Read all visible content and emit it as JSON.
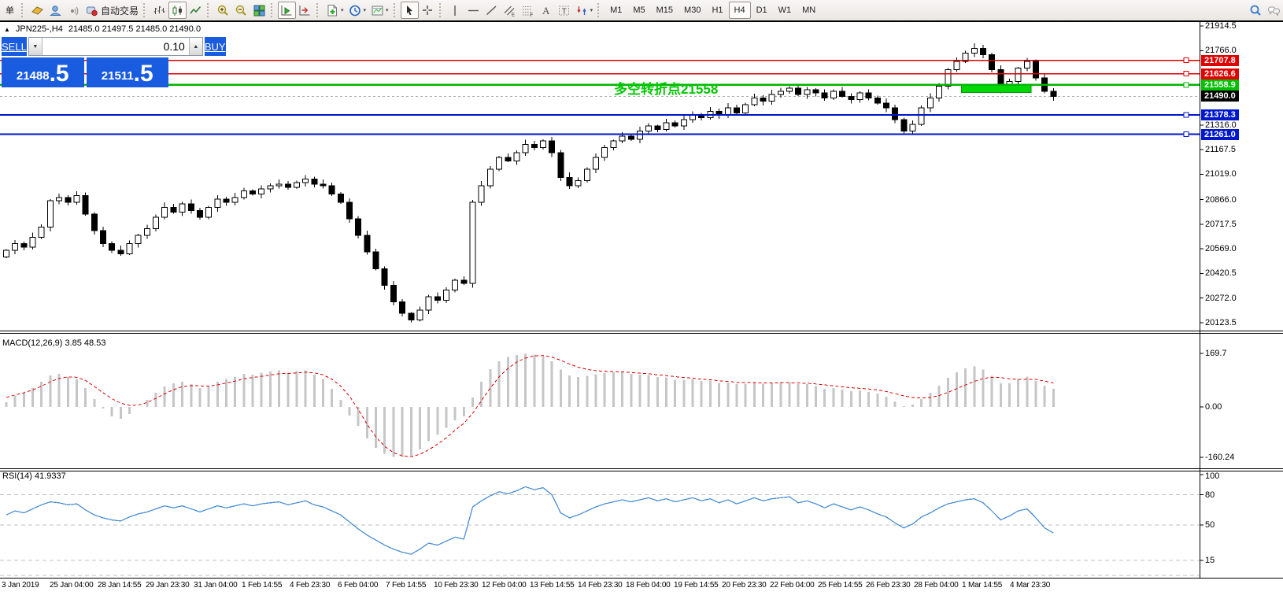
{
  "accent_colors": {
    "panel_blue": "#1a5ce0",
    "line_red": "#e00000",
    "line_green": "#00b400",
    "line_blue": "#0014c8",
    "badge_green": "#00c000",
    "badge_blue": "#0018cc",
    "annotation_green": "#00c800",
    "rsi_blue": "#4a8fd4",
    "macd_gray": "#c6c6c6"
  },
  "toolbar": {
    "caret_glyph": "▾",
    "groups": [
      {
        "name": "orders",
        "items": [
          {
            "name": "new-order-button",
            "label": "单"
          }
        ]
      },
      {
        "name": "quick",
        "items": [
          {
            "name": "market-watch-button",
            "icon": "book"
          },
          {
            "name": "profile-button",
            "icon": "profile"
          },
          {
            "name": "signals-button",
            "icon": "signal"
          },
          {
            "name": "autotrading-button",
            "icon": "autotrade",
            "label": "自动交易"
          }
        ]
      },
      {
        "name": "chart-type",
        "items": [
          {
            "name": "bar-chart-button",
            "icon": "bars"
          },
          {
            "name": "candlestick-chart-button",
            "icon": "candles",
            "active": true
          },
          {
            "name": "line-chart-button",
            "icon": "linechart"
          }
        ]
      },
      {
        "name": "zoom",
        "items": [
          {
            "name": "zoom-in-button",
            "icon": "zoomin"
          },
          {
            "name": "zoom-out-button",
            "icon": "zoomout"
          },
          {
            "name": "tile-windows-button",
            "icon": "tile"
          }
        ]
      },
      {
        "name": "scrolling",
        "items": [
          {
            "name": "auto-scroll-button",
            "icon": "autoscroll",
            "active": true
          },
          {
            "name": "chart-shift-button",
            "icon": "shift"
          }
        ]
      },
      {
        "name": "insert",
        "items": [
          {
            "name": "indicators-button",
            "icon": "indicator",
            "caret": true
          },
          {
            "name": "periods-button",
            "icon": "clock",
            "caret": true
          },
          {
            "name": "templates-button",
            "icon": "template",
            "caret": true
          }
        ]
      },
      {
        "name": "pointer",
        "items": [
          {
            "name": "cursor-button",
            "icon": "cursor",
            "active": true
          },
          {
            "name": "crosshair-button",
            "icon": "crosshair"
          }
        ]
      },
      {
        "name": "draw",
        "items": [
          {
            "name": "vertical-line-button",
            "icon": "vline"
          },
          {
            "name": "horizontal-line-button",
            "icon": "hline"
          },
          {
            "name": "trendline-button",
            "icon": "trend"
          },
          {
            "name": "equidistant-channel-button",
            "icon": "channel"
          },
          {
            "name": "fibonacci-button",
            "icon": "fibo"
          },
          {
            "name": "text-button",
            "icon": "textA"
          },
          {
            "name": "text-label-button",
            "icon": "labelT"
          },
          {
            "name": "arrows-button",
            "icon": "shapes",
            "caret": true
          }
        ]
      },
      {
        "name": "timeframes",
        "items": [
          {
            "name": "timeframe-m1",
            "label": "M1"
          },
          {
            "name": "timeframe-m5",
            "label": "M5"
          },
          {
            "name": "timeframe-m15",
            "label": "M15"
          },
          {
            "name": "timeframe-m30",
            "label": "M30"
          },
          {
            "name": "timeframe-h1",
            "label": "H1"
          },
          {
            "name": "timeframe-h4",
            "label": "H4",
            "active": true
          },
          {
            "name": "timeframe-d1",
            "label": "D1"
          },
          {
            "name": "timeframe-w1",
            "label": "W1"
          },
          {
            "name": "timeframe-mn",
            "label": "MN"
          }
        ]
      }
    ],
    "right_items": [
      {
        "name": "search-button",
        "icon": "search"
      },
      {
        "name": "chat-button",
        "icon": "chat"
      }
    ]
  },
  "chart": {
    "collapse_glyph": "▲",
    "title_symbol": "JPN225-,H4",
    "title_ohlc": "21485.0 21497.5 21485.0 21490.0",
    "annotation": {
      "text": "多空转折点21558",
      "color": "#00c800"
    }
  },
  "trade_panel": {
    "sell_label": "SELL",
    "buy_label": "BUY",
    "lot": "0.10",
    "lot_down_glyph": "▼",
    "lot_up_glyph": "▲",
    "sell_price_main": "21488",
    "sell_price_frac": ".5",
    "buy_price_main": "21511",
    "buy_price_frac": ".5"
  },
  "price_axis": {
    "ticks": [
      "21914.5",
      "21766.0",
      "21316.0",
      "21167.5",
      "21019.0",
      "20866.0",
      "20717.5",
      "20569.0",
      "20420.5",
      "20272.0",
      "20123.5"
    ],
    "badges": [
      {
        "value": "21707.8",
        "color": "#e00000",
        "role": "resistance-line-label"
      },
      {
        "value": "21626.6",
        "color": "#e00000",
        "role": "resistance-line-label"
      },
      {
        "value": "21558.9",
        "color": "#00c000",
        "role": "pivot-line-label"
      },
      {
        "value": "21490.0",
        "color": "#000000",
        "role": "current-price-label"
      },
      {
        "value": "21378.3",
        "color": "#0018cc",
        "role": "support-line-label"
      },
      {
        "value": "21261.0",
        "color": "#0018cc",
        "role": "support-line-label"
      }
    ]
  },
  "macd_pane": {
    "label": "MACD(12,26,9) 3.85 48.53",
    "axis": [
      "169.7",
      "0.00",
      "-160.24"
    ]
  },
  "rsi_pane": {
    "label": "RSI(14) 41.9337",
    "axis": [
      "100",
      "80",
      "50",
      "15"
    ],
    "levels": [
      80,
      50,
      15
    ]
  },
  "time_axis": {
    "labels": [
      "3 Jan 2019",
      "25 Jan 04:00",
      "28 Jan 14:55",
      "29 Jan 23:30",
      "31 Jan 04:00",
      "1 Feb 14:55",
      "4 Feb 23:30",
      "6 Feb 04:00",
      "7 Feb 14:55",
      "10 Feb 23:30",
      "12 Feb 04:00",
      "13 Feb 14:55",
      "14 Feb 23:30",
      "18 Feb 04:00",
      "19 Feb 14:55",
      "20 Feb 23:30",
      "22 Feb 04:00",
      "25 Feb 14:55",
      "26 Feb 23:30",
      "28 Feb 04:00",
      "1 Mar 14:55",
      "4 Mar 23:30"
    ]
  },
  "chart_data": [
    {
      "type": "candlestick",
      "symbol": "JPN225-",
      "period": "H4",
      "open": 21485.0,
      "high": 21497.5,
      "low": 21485.0,
      "close": 21490.0,
      "ylim": [
        20123.5,
        21914.5
      ],
      "closes": [
        20560,
        20600,
        20580,
        20640,
        20700,
        20860,
        20880,
        20850,
        20890,
        20780,
        20680,
        20600,
        20560,
        20540,
        20600,
        20650,
        20690,
        20760,
        20820,
        20790,
        20840,
        20800,
        20760,
        20820,
        20870,
        20850,
        20880,
        20920,
        20900,
        20930,
        20950,
        20960,
        20940,
        20970,
        20990,
        20960,
        20950,
        20900,
        20850,
        20750,
        20650,
        20550,
        20450,
        20350,
        20250,
        20180,
        20140,
        20200,
        20280,
        20260,
        20320,
        20380,
        20360,
        20850,
        20950,
        21050,
        21120,
        21100,
        21150,
        21200,
        21180,
        21220,
        21150,
        21000,
        20950,
        20980,
        21050,
        21120,
        21180,
        21220,
        21250,
        21230,
        21280,
        21310,
        21290,
        21330,
        21310,
        21350,
        21380,
        21360,
        21400,
        21380,
        21420,
        21390,
        21440,
        21480,
        21460,
        21500,
        21520,
        21540,
        21500,
        21530,
        21510,
        21480,
        21520,
        21490,
        21470,
        21510,
        21480,
        21450,
        21420,
        21350,
        21280,
        21320,
        21420,
        21480,
        21550,
        21650,
        21700,
        21750,
        21780,
        21740,
        21650,
        21520,
        21580,
        21660,
        21700,
        21600,
        21520,
        21490
      ],
      "hlines": [
        {
          "price": 21707.8,
          "color": "#e00000",
          "width": 1.5
        },
        {
          "price": 21626.6,
          "color": "#e00000",
          "width": 1.5
        },
        {
          "price": 21558.9,
          "color": "#00b400",
          "width": 2.5
        },
        {
          "price": 21378.3,
          "color": "#0014c8",
          "width": 2
        },
        {
          "price": 21261.0,
          "color": "#0014c8",
          "width": 2
        }
      ],
      "current_price_line": {
        "price": 21490.0,
        "style": "dashed-gray"
      },
      "green_zone": {
        "bar_from": 109,
        "bar_to": 116,
        "price_top": 21558.9,
        "price_bottom": 21512,
        "fill": "#00d800"
      }
    },
    {
      "type": "bar",
      "name": "MACD histogram",
      "ylim": [
        -160.24,
        169.7
      ],
      "values": [
        15,
        35,
        45,
        60,
        80,
        100,
        105,
        95,
        88,
        60,
        25,
        -5,
        -30,
        -38,
        -22,
        0,
        22,
        45,
        65,
        75,
        80,
        72,
        60,
        66,
        80,
        88,
        95,
        105,
        102,
        108,
        112,
        116,
        108,
        113,
        116,
        102,
        88,
        58,
        22,
        -28,
        -60,
        -100,
        -130,
        -148,
        -158,
        -160,
        -155,
        -135,
        -108,
        -88,
        -66,
        -42,
        -30,
        30,
        80,
        120,
        145,
        158,
        165,
        169,
        166,
        160,
        145,
        118,
        100,
        95,
        98,
        104,
        107,
        110,
        110,
        105,
        102,
        101,
        95,
        94,
        86,
        86,
        88,
        82,
        84,
        76,
        78,
        72,
        74,
        78,
        74,
        76,
        78,
        79,
        72,
        72,
        66,
        58,
        60,
        55,
        50,
        53,
        48,
        42,
        32,
        18,
        2,
        8,
        25,
        45,
        68,
        92,
        110,
        122,
        128,
        118,
        98,
        75,
        75,
        88,
        96,
        82,
        68,
        58
      ]
    },
    {
      "type": "line",
      "name": "MACD signal",
      "values": [
        30,
        38,
        45,
        54,
        66,
        80,
        90,
        95,
        94,
        84,
        65,
        45,
        26,
        12,
        5,
        6,
        14,
        27,
        42,
        55,
        64,
        68,
        67,
        66,
        70,
        76,
        82,
        89,
        93,
        97,
        101,
        105,
        106,
        108,
        110,
        108,
        102,
        88,
        66,
        34,
        -8,
        -55,
        -95,
        -125,
        -145,
        -155,
        -158,
        -150,
        -136,
        -118,
        -98,
        -74,
        -52,
        -20,
        20,
        60,
        95,
        122,
        142,
        155,
        162,
        163,
        158,
        148,
        136,
        126,
        119,
        115,
        113,
        112,
        111,
        109,
        107,
        105,
        102,
        99,
        96,
        93,
        91,
        88,
        86,
        83,
        81,
        78,
        77,
        77,
        76,
        76,
        77,
        77,
        76,
        75,
        73,
        70,
        67,
        64,
        61,
        59,
        57,
        54,
        49,
        42,
        35,
        30,
        28,
        30,
        36,
        46,
        58,
        70,
        81,
        90,
        94,
        93,
        89,
        87,
        88,
        87,
        82,
        76
      ]
    },
    {
      "type": "line",
      "name": "RSI",
      "ylim": [
        0,
        100
      ],
      "last_value": 41.9337,
      "values": [
        60,
        64,
        62,
        66,
        70,
        73,
        72,
        70,
        71,
        65,
        60,
        57,
        55,
        54,
        58,
        61,
        63,
        66,
        69,
        67,
        69,
        66,
        63,
        66,
        69,
        67,
        69,
        71,
        69,
        71,
        72,
        73,
        70,
        72,
        74,
        70,
        68,
        64,
        60,
        53,
        46,
        40,
        35,
        30,
        26,
        23,
        21,
        26,
        32,
        30,
        34,
        38,
        36,
        68,
        74,
        79,
        83,
        81,
        84,
        88,
        85,
        87,
        80,
        62,
        57,
        60,
        64,
        68,
        71,
        73,
        75,
        73,
        75,
        77,
        74,
        76,
        73,
        75,
        77,
        74,
        76,
        72,
        75,
        71,
        74,
        77,
        74,
        76,
        77,
        78,
        72,
        74,
        71,
        67,
        71,
        68,
        65,
        68,
        65,
        61,
        58,
        52,
        47,
        51,
        58,
        62,
        67,
        71,
        73,
        75,
        76,
        72,
        64,
        55,
        59,
        64,
        66,
        57,
        47,
        42
      ]
    }
  ]
}
